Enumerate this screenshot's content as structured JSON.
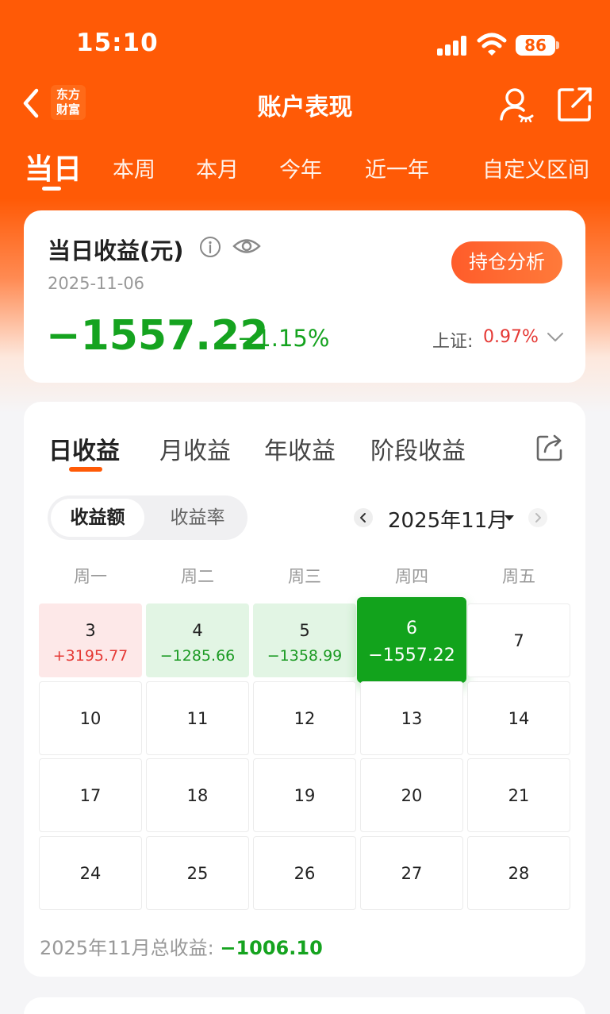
{
  "status_bar": {
    "time": "15:10",
    "battery": "86"
  },
  "nav": {
    "title": "账户表现",
    "brand_logo_text": "东方财富"
  },
  "period_tabs": [
    {
      "label": "当日",
      "active": true
    },
    {
      "label": "本周",
      "active": false
    },
    {
      "label": "本月",
      "active": false
    },
    {
      "label": "今年",
      "active": false
    },
    {
      "label": "近一年",
      "active": false
    },
    {
      "label": "自定义区间",
      "active": false
    }
  ],
  "summary": {
    "title": "当日收益(元)",
    "date": "2025-11-06",
    "value": "−1557.22",
    "percent": "−1.15%",
    "holding_button": "持仓分析",
    "index_label": "上证:",
    "index_value": "0.97%"
  },
  "calendar": {
    "tabs": [
      {
        "label": "日收益",
        "active": true
      },
      {
        "label": "月收益",
        "active": false
      },
      {
        "label": "年收益",
        "active": false
      },
      {
        "label": "阶段收益",
        "active": false
      }
    ],
    "toggle": {
      "active": "收益额",
      "inactive": "收益率"
    },
    "month_label": "2025年11月",
    "weekdays": [
      "周一",
      "周二",
      "周三",
      "周四",
      "周五"
    ],
    "rows": [
      [
        {
          "day": "3",
          "value": "+3195.77",
          "kind": "gain"
        },
        {
          "day": "4",
          "value": "−1285.66",
          "kind": "loss"
        },
        {
          "day": "5",
          "value": "−1358.99",
          "kind": "loss"
        },
        {
          "day": "6",
          "value": "−1557.22",
          "kind": "sel"
        },
        {
          "day": "7",
          "value": "",
          "kind": "plain"
        }
      ],
      [
        {
          "day": "10",
          "value": "",
          "kind": "plain"
        },
        {
          "day": "11",
          "value": "",
          "kind": "plain"
        },
        {
          "day": "12",
          "value": "",
          "kind": "plain"
        },
        {
          "day": "13",
          "value": "",
          "kind": "plain"
        },
        {
          "day": "14",
          "value": "",
          "kind": "plain"
        }
      ],
      [
        {
          "day": "17",
          "value": "",
          "kind": "plain"
        },
        {
          "day": "18",
          "value": "",
          "kind": "plain"
        },
        {
          "day": "19",
          "value": "",
          "kind": "plain"
        },
        {
          "day": "20",
          "value": "",
          "kind": "plain"
        },
        {
          "day": "21",
          "value": "",
          "kind": "plain"
        }
      ],
      [
        {
          "day": "24",
          "value": "",
          "kind": "plain"
        },
        {
          "day": "25",
          "value": "",
          "kind": "plain"
        },
        {
          "day": "26",
          "value": "",
          "kind": "plain"
        },
        {
          "day": "27",
          "value": "",
          "kind": "plain"
        },
        {
          "day": "28",
          "value": "",
          "kind": "plain"
        }
      ]
    ],
    "total_label": "2025年11月总收益:",
    "total_value": "−1006.10"
  },
  "colors": {
    "brand": "#ff5a06",
    "loss": "#15a31f",
    "gain": "#e53935"
  },
  "icons": [
    "back-icon",
    "user-icon",
    "share-icon",
    "info-icon",
    "eye-icon",
    "chevron-down-icon",
    "export-icon",
    "month-prev-icon",
    "month-next-icon"
  ]
}
